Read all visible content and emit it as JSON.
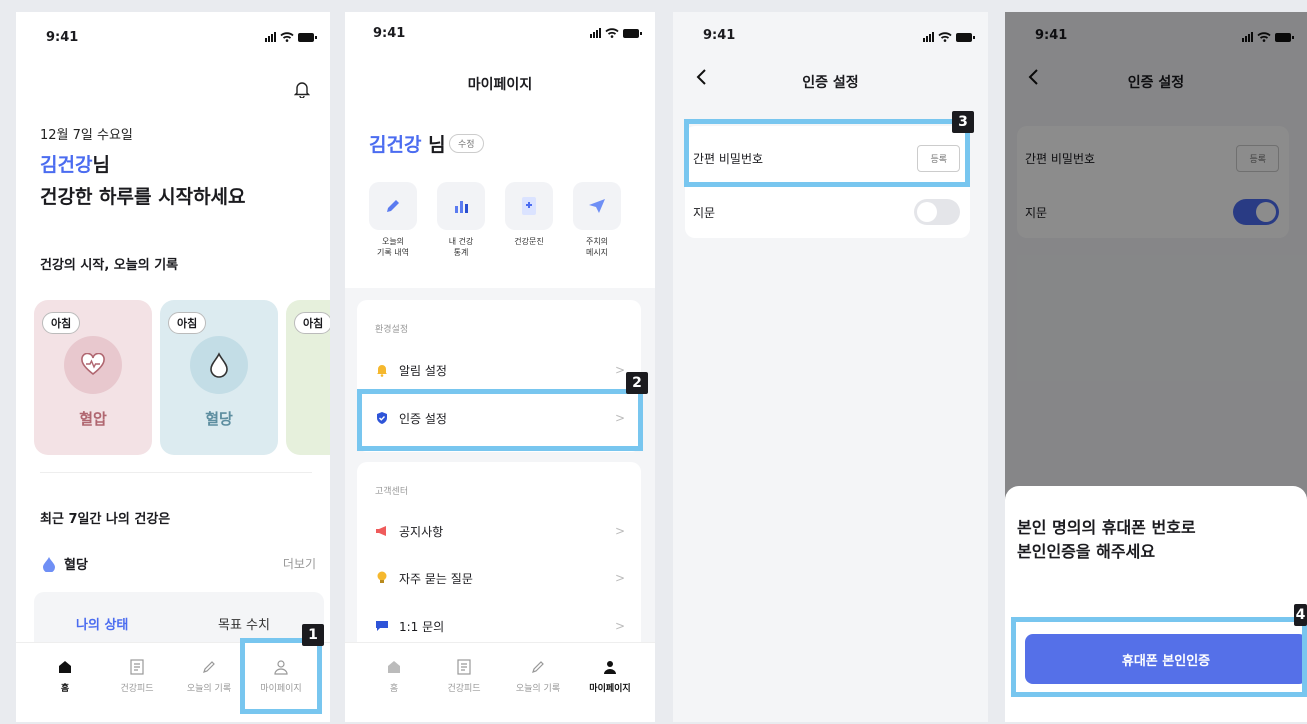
{
  "status": {
    "time": "9:41"
  },
  "screen1": {
    "date": "12월 7일 수요일",
    "user_name": "김건강",
    "name_suffix": "님",
    "greeting": "건강한 하루를 시작하세요",
    "section_title": "건강의 시작, 오늘의 기록",
    "cards": [
      {
        "badge": "아침",
        "label": "혈압",
        "icon": "heart-pulse-icon"
      },
      {
        "badge": "아침",
        "label": "혈당",
        "icon": "water-drop-icon"
      },
      {
        "badge": "아침",
        "label": "",
        "icon": ""
      }
    ],
    "recent_title": "최근 7일간 나의 건강은",
    "metric": "혈당",
    "more": "더보기",
    "tabs": [
      "나의 상태",
      "목표 수치"
    ]
  },
  "tabbar": {
    "items": [
      {
        "label": "홈",
        "icon": "home-icon"
      },
      {
        "label": "건강피드",
        "icon": "feed-icon"
      },
      {
        "label": "오늘의 기록",
        "icon": "pencil-icon"
      },
      {
        "label": "마이페이지",
        "icon": "person-icon"
      }
    ]
  },
  "screen2": {
    "title": "마이페이지",
    "user_name": "김건강",
    "name_suffix": " 님",
    "edit": "수정",
    "quick_actions": [
      {
        "label": "오늘의\n기록 내역",
        "icon": "pencil-icon"
      },
      {
        "label": "내 건강\n통계",
        "icon": "bar-chart-icon"
      },
      {
        "label": "건강문진",
        "icon": "document-plus-icon"
      },
      {
        "label": "주치의\n메시지",
        "icon": "paper-plane-icon"
      }
    ],
    "group1_title": "환경설정",
    "group1_items": [
      {
        "label": "알림 설정",
        "icon": "bell-icon"
      },
      {
        "label": "인증 설정",
        "icon": "shield-check-icon"
      }
    ],
    "group2_title": "고객센터",
    "group2_items": [
      {
        "label": "공지사항",
        "icon": "megaphone-icon"
      },
      {
        "label": "자주 묻는 질문",
        "icon": "lightbulb-icon"
      },
      {
        "label": "1:1 문의",
        "icon": "chat-icon"
      }
    ]
  },
  "screen3": {
    "title": "인증 설정",
    "pin_label": "간편 비밀번호",
    "register": "등록",
    "fingerprint_label": "지문"
  },
  "screen4": {
    "title": "인증 설정",
    "pin_label": "간편 비밀번호",
    "register": "등록",
    "fingerprint_label": "지문",
    "sheet_line1": "본인 명의의 휴대폰 번호로",
    "sheet_line2": "본인인증을 해주세요",
    "cta": "휴대폰 본인인증"
  },
  "callouts": [
    "1",
    "2",
    "3",
    "4"
  ],
  "colors": {
    "accent": "#4b6cf0",
    "highlight": "#78c6ef",
    "cta": "#5570e8"
  }
}
